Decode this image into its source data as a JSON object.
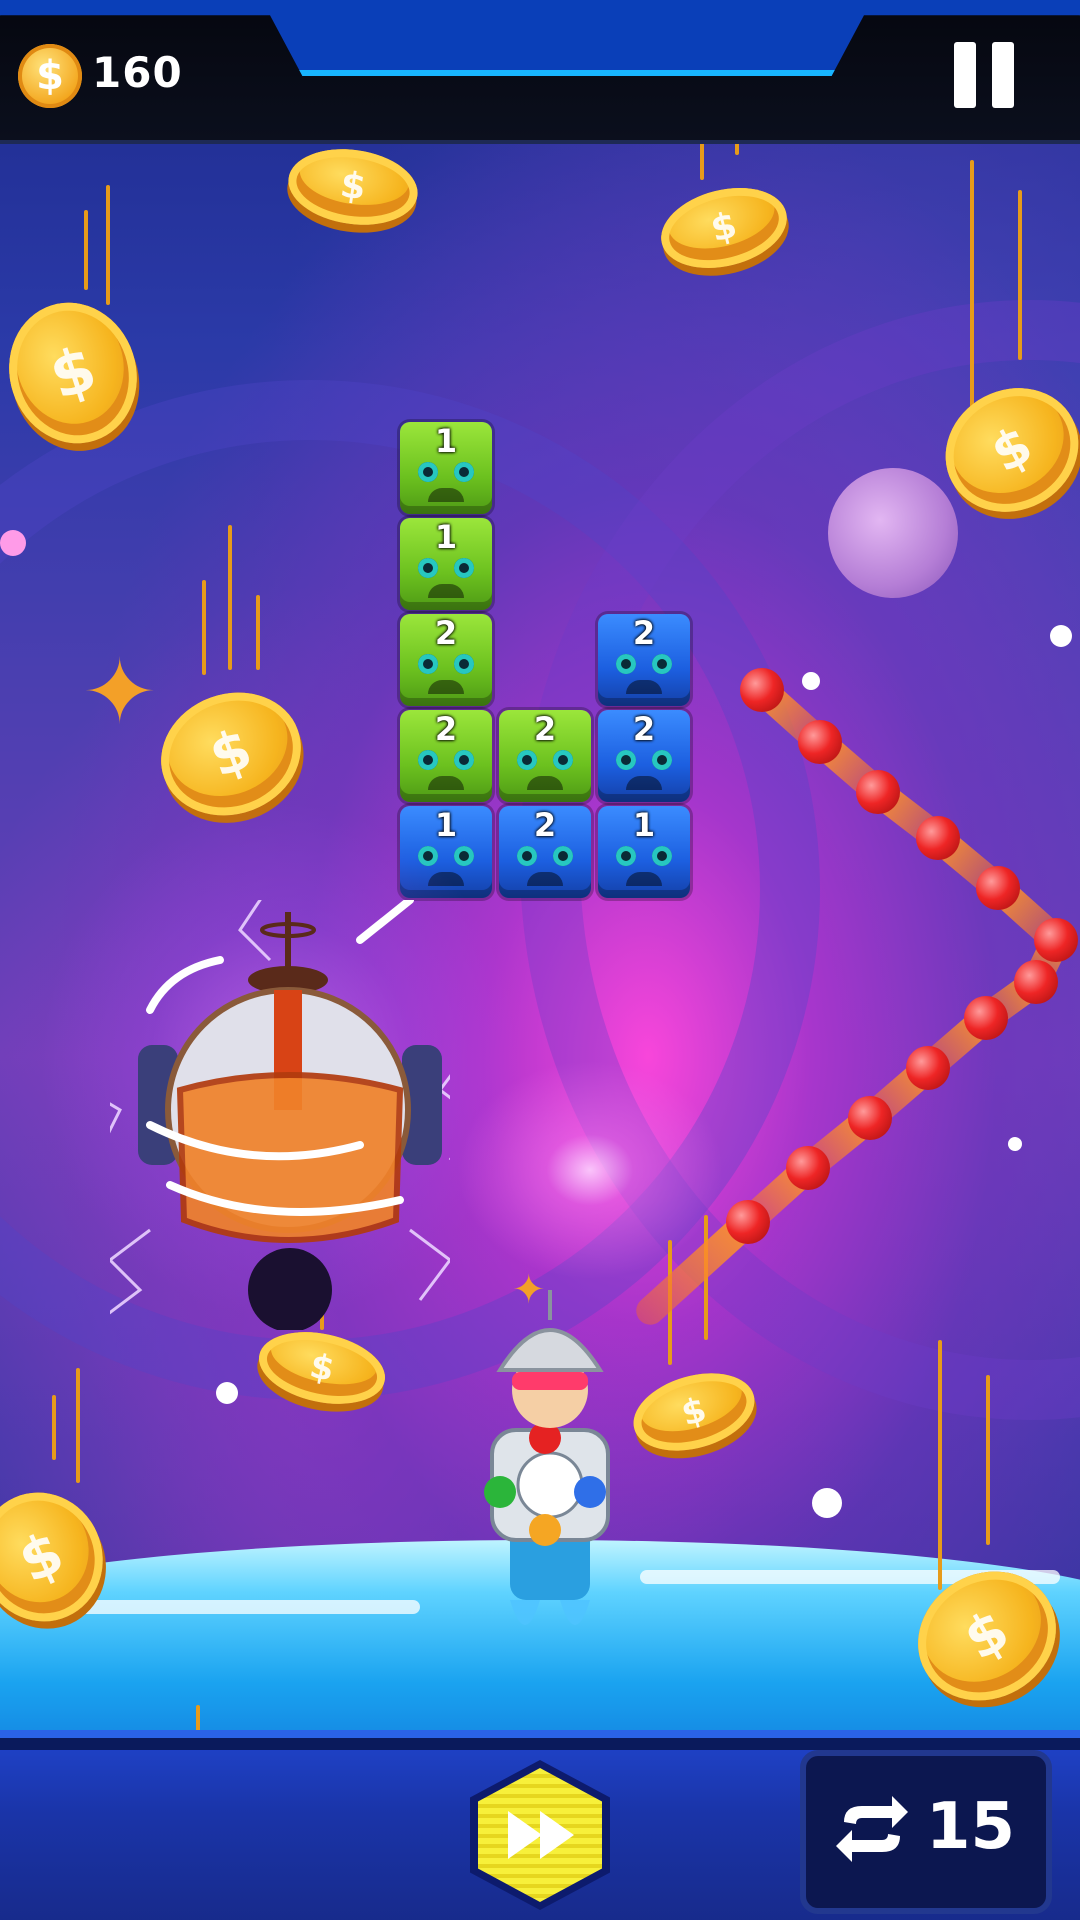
{
  "hud": {
    "coins": "160",
    "coin_symbol": "$",
    "pause_icon": "pause-icon",
    "fast_forward_icon": "fast-forward-icon",
    "swap_icon": "swap-icon",
    "swaps_left": "15"
  },
  "board": {
    "blocks": [
      {
        "color": "green",
        "value": "1"
      },
      {
        "color": "green",
        "value": "1"
      },
      {
        "color": "green",
        "value": "2"
      },
      {
        "color": "blue",
        "value": "2"
      },
      {
        "color": "green",
        "value": "2"
      },
      {
        "color": "green",
        "value": "2"
      },
      {
        "color": "blue",
        "value": "2"
      },
      {
        "color": "blue",
        "value": "1"
      },
      {
        "color": "blue",
        "value": "2"
      },
      {
        "color": "blue",
        "value": "1"
      }
    ]
  },
  "coin_glyph": "$",
  "colors": {
    "green_block": "#6cc11f",
    "blue_block": "#1c5fe0",
    "ball": "#ee2525",
    "coin": "#f6b51f",
    "hud_glow": "#18b5ff"
  }
}
